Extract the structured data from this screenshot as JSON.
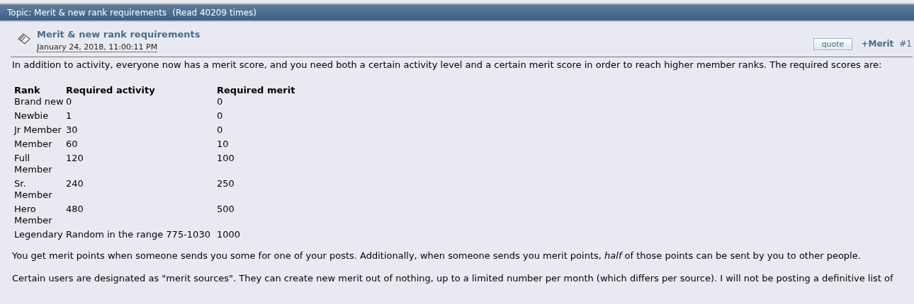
{
  "topic_bar": {
    "title": "Topic: Merit & new rank requirements",
    "read_count": "(Read 40209 times)"
  },
  "post": {
    "title": "Merit & new rank requirements",
    "date": "January 24, 2018, 11:00:11 PM",
    "quote_button": "quote",
    "merit_link": "+Merit",
    "post_number": "#1",
    "intro": "In addition to activity, everyone now has a merit score, and you need both a certain activity level and a certain merit score in order to reach higher member ranks. The required scores are:",
    "table": {
      "columns": [
        "Rank",
        "Required activity",
        "Required merit"
      ],
      "rows": [
        [
          "Brand new",
          "0",
          "0"
        ],
        [
          "Newbie",
          "1",
          "0"
        ],
        [
          "Jr Member",
          "30",
          "0"
        ],
        [
          "Member",
          "60",
          "10"
        ],
        [
          "Full Member",
          "120",
          "100"
        ],
        [
          "Sr. Member",
          "240",
          "250"
        ],
        [
          "Hero Member",
          "480",
          "500"
        ],
        [
          "Legendary",
          "Random in the range 775-1030",
          "1000"
        ]
      ]
    },
    "paragraphs": [
      "You get merit points when someone sends you some for one of your posts. Additionally, when someone sends you merit points, *half* of those points can be sent by you to other people.",
      "Certain users are designated as \"merit sources\". They can create new merit out of nothing, up to a limited number per month (which differs per source). I will not be posting a definitive list of"
    ]
  }
}
